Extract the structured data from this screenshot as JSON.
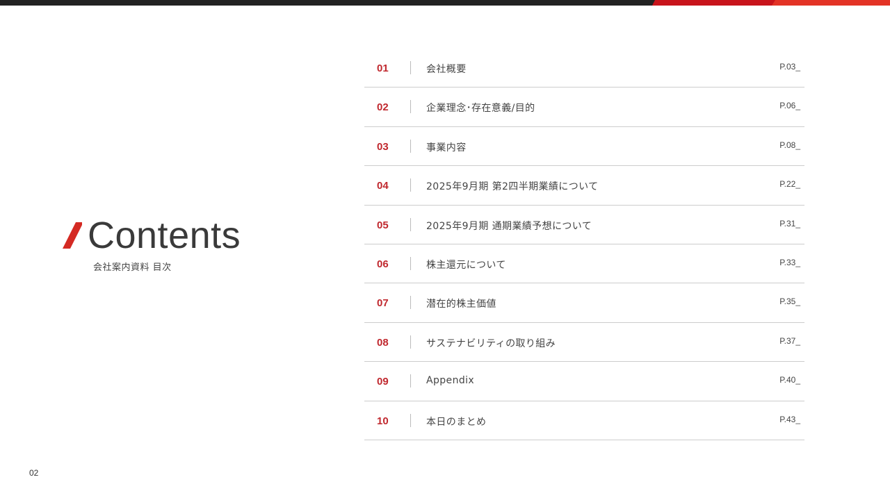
{
  "header": {
    "colors": {
      "bar": "#222222",
      "accent_dark": "#c8141b",
      "accent_light": "#e33326"
    }
  },
  "title_block": {
    "title": "Contents",
    "subtitle": "会社案内資料 目次",
    "slash_color": "#d42a23"
  },
  "toc": {
    "number_color": "#c0282e",
    "items": [
      {
        "num": "01",
        "label": "会社概要",
        "page": "P.03_"
      },
      {
        "num": "02",
        "label": "企業理念･存在意義/目的",
        "page": "P.06_"
      },
      {
        "num": "03",
        "label": "事業内容",
        "page": "P.08_"
      },
      {
        "num": "04",
        "label": "2025年9月期 第2四半期業績について",
        "page": "P.22_"
      },
      {
        "num": "05",
        "label": "2025年9月期 通期業績予想について",
        "page": "P.31_"
      },
      {
        "num": "06",
        "label": "株主還元について",
        "page": "P.33_"
      },
      {
        "num": "07",
        "label": "潜在的株主価値",
        "page": "P.35_"
      },
      {
        "num": "08",
        "label": "サステナビリティの取り組み",
        "page": "P.37_"
      },
      {
        "num": "09",
        "label": "Appendix",
        "page": "P.40_"
      },
      {
        "num": "10",
        "label": "本日のまとめ",
        "page": "P.43_"
      }
    ]
  },
  "footer": {
    "page_number": "02"
  }
}
